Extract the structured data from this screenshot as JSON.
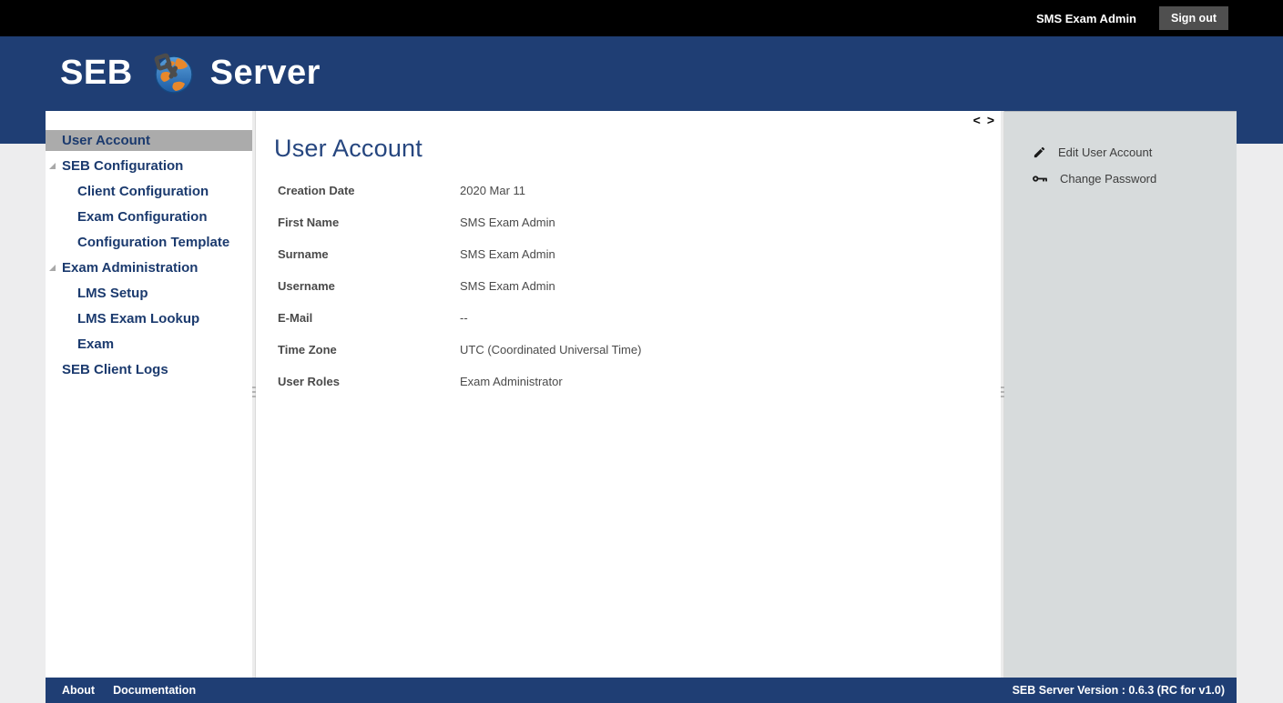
{
  "topbar": {
    "user": "SMS Exam Admin",
    "sign_out": "Sign out"
  },
  "brand": {
    "seb": "SEB",
    "server": "Server",
    "logo_icon": "globe-lock-icon"
  },
  "colors": {
    "header_blue": "#1f3e74",
    "topbar_black": "#000000",
    "nav_text": "#1b3a6e",
    "nav_selected_bg": "#ababab",
    "title_blue": "#26467f",
    "panel_gray": "#d7dbdc",
    "body_gray": "#ededee"
  },
  "sidebar": {
    "items": [
      {
        "label": "User Account",
        "level": 0,
        "selected": true,
        "expandable": false
      },
      {
        "label": "SEB Configuration",
        "level": 0,
        "selected": false,
        "expandable": true
      },
      {
        "label": "Client Configuration",
        "level": 1,
        "selected": false,
        "expandable": false
      },
      {
        "label": "Exam Configuration",
        "level": 1,
        "selected": false,
        "expandable": false
      },
      {
        "label": "Configuration Template",
        "level": 1,
        "selected": false,
        "expandable": false
      },
      {
        "label": "Exam Administration",
        "level": 0,
        "selected": false,
        "expandable": true
      },
      {
        "label": "LMS Setup",
        "level": 1,
        "selected": false,
        "expandable": false
      },
      {
        "label": "LMS Exam Lookup",
        "level": 1,
        "selected": false,
        "expandable": false
      },
      {
        "label": "Exam",
        "level": 1,
        "selected": false,
        "expandable": false
      },
      {
        "label": "SEB Client Logs",
        "level": 0,
        "selected": false,
        "expandable": false
      }
    ],
    "expand_icon": "triangle-expand-icon"
  },
  "main": {
    "title": "User Account",
    "nav_back": "<",
    "nav_forward": ">",
    "fields": [
      {
        "label": "Creation Date",
        "value": "2020 Mar 11"
      },
      {
        "label": "First Name",
        "value": "SMS Exam Admin"
      },
      {
        "label": "Surname",
        "value": "SMS Exam Admin"
      },
      {
        "label": "Username",
        "value": "SMS Exam Admin"
      },
      {
        "label": "E-Mail",
        "value": "--"
      },
      {
        "label": "Time Zone",
        "value": "UTC (Coordinated Universal Time)"
      },
      {
        "label": "User Roles",
        "value": "Exam Administrator"
      }
    ]
  },
  "actions": [
    {
      "label": "Edit User Account",
      "icon": "pencil-icon"
    },
    {
      "label": "Change Password",
      "icon": "key-icon"
    }
  ],
  "footer": {
    "about": "About",
    "documentation": "Documentation",
    "version": "SEB Server Version : 0.6.3 (RC for v1.0)"
  }
}
